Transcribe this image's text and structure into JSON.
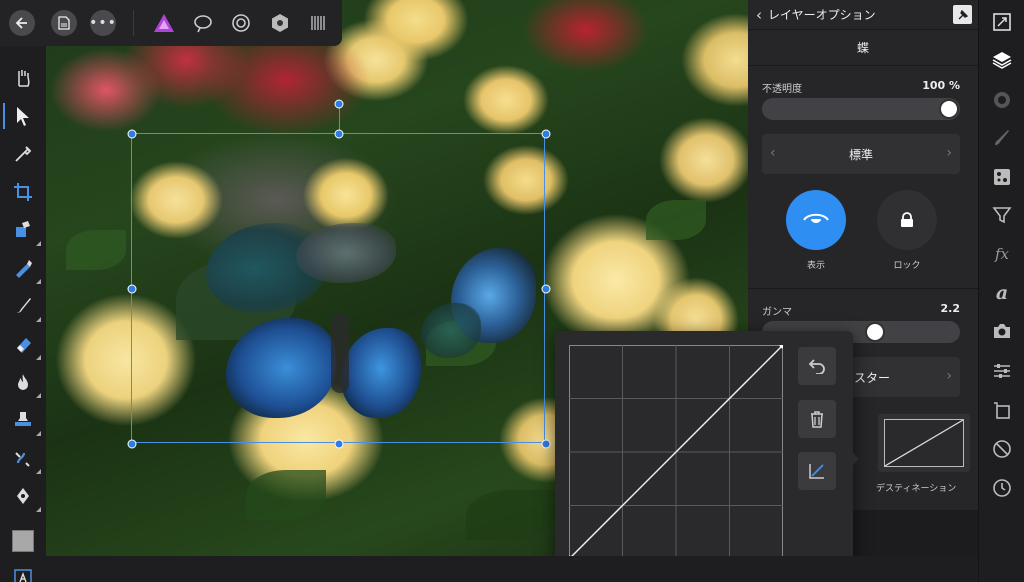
{
  "topbar": {
    "back_icon": "arrow-left-icon",
    "document_icon": "document-icon",
    "more_icon": "more-dots-icon",
    "persona_icons": [
      "photo-persona-icon",
      "liquify-persona-icon",
      "develop-persona-icon",
      "tone-map-persona-icon",
      "export-persona-icon"
    ]
  },
  "tools": [
    "hand",
    "move",
    "color-picker",
    "crop",
    "selection-brush",
    "flood-select",
    "paint-brush",
    "erase-brush",
    "dodge-burn",
    "clone-stamp",
    "healing",
    "pen",
    "color-swatch",
    "text"
  ],
  "panel": {
    "header_title": "レイヤーオプション",
    "layer_name": "蝶",
    "opacity_label": "不透明度",
    "opacity_value": "100 %",
    "opacity_fraction": 1.0,
    "blend_mode": "標準",
    "visible_label": "表示",
    "lock_label": "ロック",
    "gamma_label": "ガンマ",
    "gamma_value": "2.2",
    "gamma_fraction": 0.58,
    "blend_range_label": "スター",
    "destination_label": "デスティネーション"
  },
  "right_strip_icons": [
    "navigator-icon",
    "layers-icon",
    "channels-icon",
    "brushes-icon",
    "adjustments-icon",
    "filters-icon",
    "fx-icon",
    "text-styles-icon",
    "camera-icon",
    "sliders-icon",
    "transform-icon",
    "blocked-icon",
    "history-icon"
  ],
  "curves": {
    "undo_icon": "undo-icon",
    "delete_icon": "trash-icon",
    "reset_icon": "curve-reset-icon"
  },
  "colors": {
    "accent": "#2f8ef2",
    "selection": "#4a90e2",
    "panel_bg": "#262628"
  }
}
